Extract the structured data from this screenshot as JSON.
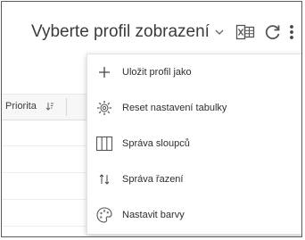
{
  "toolbar": {
    "profile_label": "Vyberte profil zobrazení",
    "icons": [
      "chevron-down-icon",
      "excel-export-icon",
      "refresh-icon",
      "more-vertical-icon"
    ]
  },
  "table": {
    "columns": [
      {
        "label": "Priorita",
        "sort_icon": "sort-icon"
      }
    ]
  },
  "menu": {
    "items": [
      {
        "label": "Uložit profil jako",
        "icon": "plus-icon"
      },
      {
        "label": "Reset nastavení tabulky",
        "icon": "gear-reset-icon"
      },
      {
        "label": "Správa sloupců",
        "icon": "columns-icon"
      },
      {
        "label": "Správa řazení",
        "icon": "sort-order-icon"
      },
      {
        "label": "Nastavit barvy",
        "icon": "palette-icon"
      }
    ]
  },
  "colors": {
    "text": "#3b3b3b",
    "border": "#5b5b5b",
    "menu_bg": "#ffffff",
    "header_bg": "#f7f7f7"
  }
}
